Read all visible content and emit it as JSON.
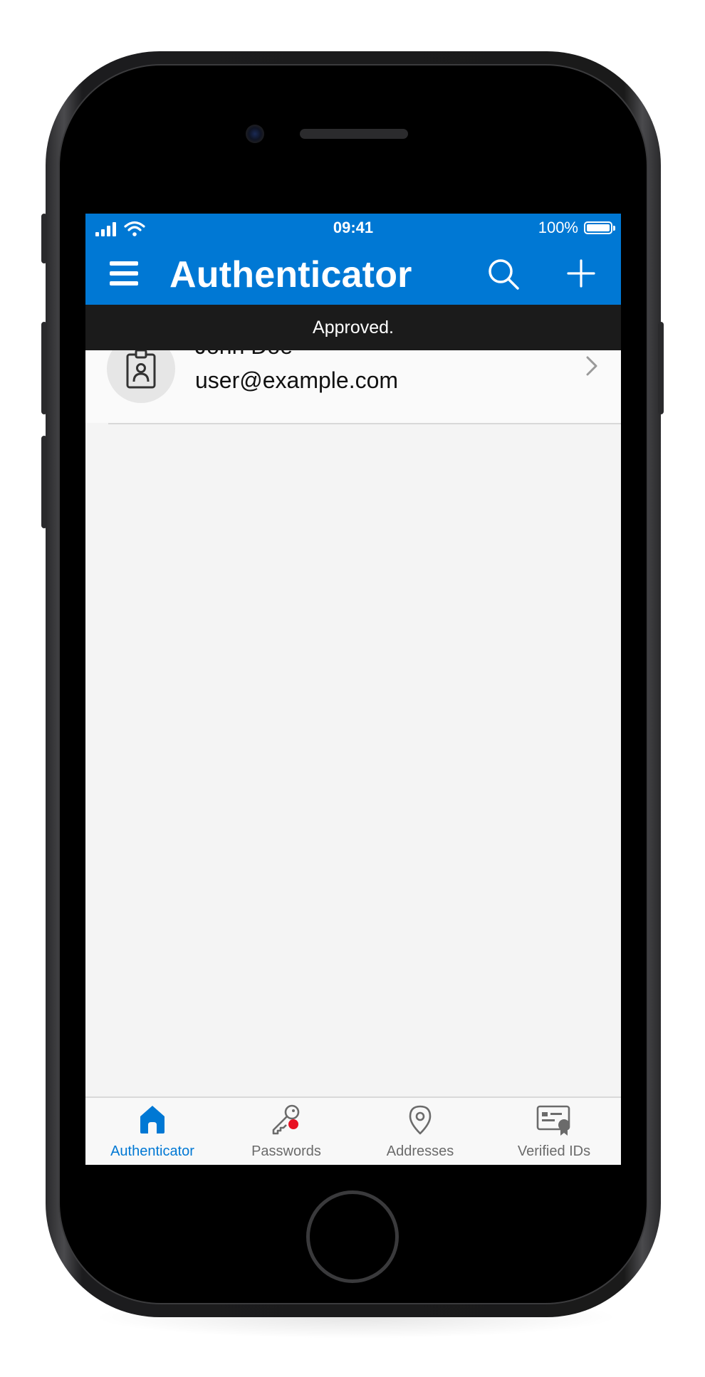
{
  "status_bar": {
    "time": "09:41",
    "battery": "100%",
    "battery_level": 1.0
  },
  "app_bar": {
    "title": "Authenticator",
    "icons": [
      "menu-icon",
      "search-icon",
      "add-icon"
    ]
  },
  "toast": {
    "message": "Approved."
  },
  "account": {
    "name": "John Doe",
    "email": "user@example.com",
    "icon": "id-badge-icon"
  },
  "tabs": [
    {
      "label": "Authenticator",
      "icon": "home-icon",
      "active": true
    },
    {
      "label": "Passwords",
      "icon": "key-icon",
      "active": false
    },
    {
      "label": "Addresses",
      "icon": "location-pin-icon",
      "active": false
    },
    {
      "label": "Verified IDs",
      "icon": "verified-id-card-icon",
      "active": false
    }
  ],
  "colors": {
    "accent": "#0078d4",
    "toast_bg": "#1b1b1b",
    "badge_red": "#e81123"
  }
}
